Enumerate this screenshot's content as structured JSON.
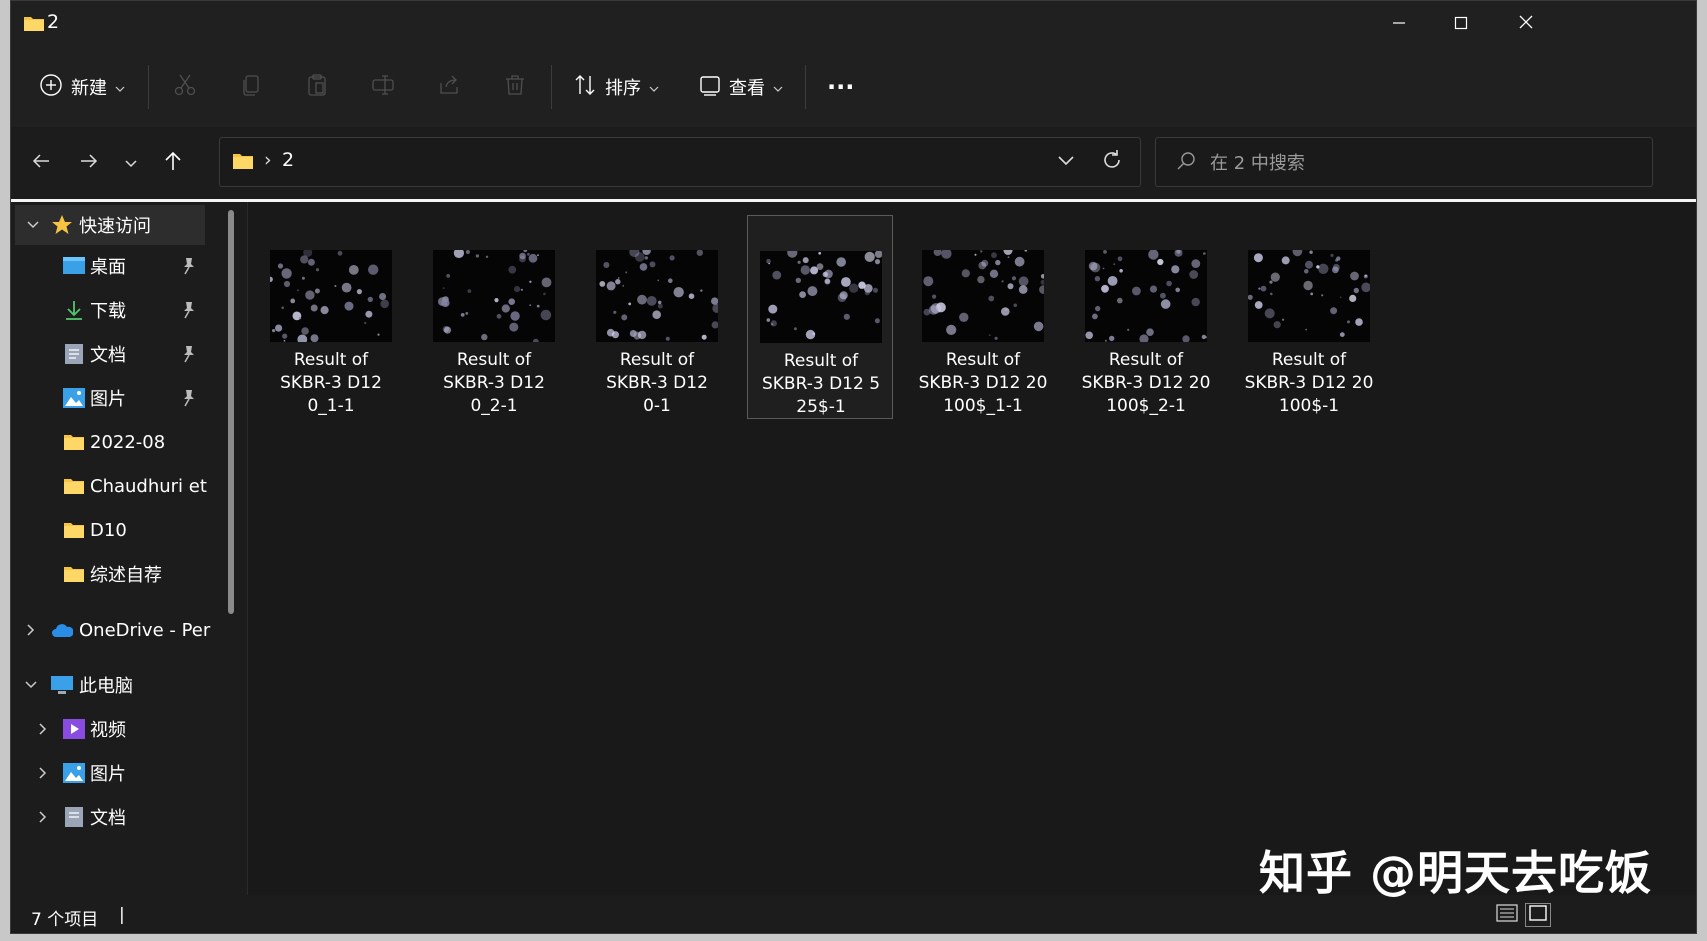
{
  "window": {
    "title": "2",
    "controls": [
      "minimize-icon",
      "maximize-icon",
      "close-icon"
    ]
  },
  "toolbar": {
    "new_label": "新建",
    "sort_label": "排序",
    "view_label": "查看",
    "more_label": "···"
  },
  "address": {
    "separator": "›",
    "path": "2"
  },
  "search": {
    "placeholder": "在 2 中搜索"
  },
  "sidebar": {
    "quick_access": "快速访问",
    "items": [
      {
        "label": "桌面",
        "icon": "desktop-icon",
        "pinned": true
      },
      {
        "label": "下载",
        "icon": "download-icon",
        "pinned": true
      },
      {
        "label": "文档",
        "icon": "documents-icon",
        "pinned": true
      },
      {
        "label": "图片",
        "icon": "pictures-icon",
        "pinned": true
      },
      {
        "label": "2022-08",
        "icon": "folder-icon",
        "pinned": false
      },
      {
        "label": "Chaudhuri et a",
        "icon": "folder-icon",
        "pinned": false
      },
      {
        "label": "D10",
        "icon": "folder-icon",
        "pinned": false
      },
      {
        "label": "综述自荐",
        "icon": "folder-icon",
        "pinned": false
      }
    ],
    "onedrive": "OneDrive - Pers",
    "this_pc": "此电脑",
    "pc_items": [
      {
        "label": "视频",
        "icon": "videos-icon"
      },
      {
        "label": "图片",
        "icon": "pictures-icon"
      },
      {
        "label": "文档",
        "icon": "documents-icon"
      }
    ]
  },
  "files": [
    {
      "line1": "Result of",
      "line2": "SKBR-3 D12",
      "line3": "0_1-1"
    },
    {
      "line1": "Result of",
      "line2": "SKBR-3 D12",
      "line3": "0_2-1"
    },
    {
      "line1": "Result of",
      "line2": "SKBR-3 D12",
      "line3": "0-1"
    },
    {
      "line1": "Result of",
      "line2": "SKBR-3 D12 5",
      "line3": "25$-1"
    },
    {
      "line1": "Result of",
      "line2": "SKBR-3 D12 20",
      "line3": "100$_1-1"
    },
    {
      "line1": "Result of",
      "line2": "SKBR-3 D12 20",
      "line3": "100$_2-1"
    },
    {
      "line1": "Result of",
      "line2": "SKBR-3 D12 20",
      "line3": "100$-1"
    }
  ],
  "status": {
    "count": "7 个项目",
    "caret": "|"
  },
  "watermark": "知乎 @明天去吃饭",
  "colors": {
    "background": "#191919",
    "chrome": "#202020",
    "folder": "#f6c343",
    "accent": "#ffffff"
  }
}
